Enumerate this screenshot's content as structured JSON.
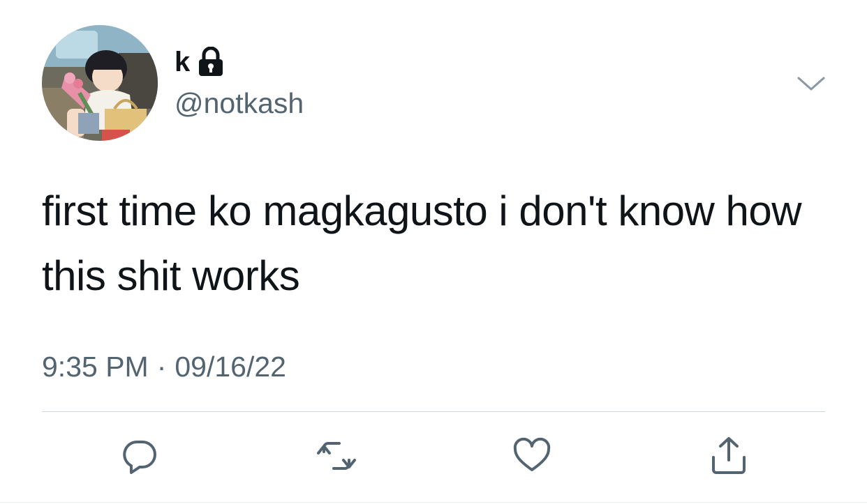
{
  "user": {
    "display_name": "k",
    "handle": "@notkash",
    "protected": true,
    "avatar": "anime-character-avatar"
  },
  "tweet": {
    "text": "first time ko magkagusto i don't know how this shit works",
    "time": "9:35 PM",
    "separator": "·",
    "date": "09/16/22"
  },
  "icons": {
    "lock": "lock-icon",
    "more": "chevron-down-icon",
    "reply": "reply-icon",
    "retweet": "retweet-icon",
    "like": "heart-icon",
    "share": "share-icon"
  },
  "colors": {
    "text": "#0f1419",
    "secondary": "#536471",
    "icon": "#536471",
    "divider": "#cfd9de"
  }
}
